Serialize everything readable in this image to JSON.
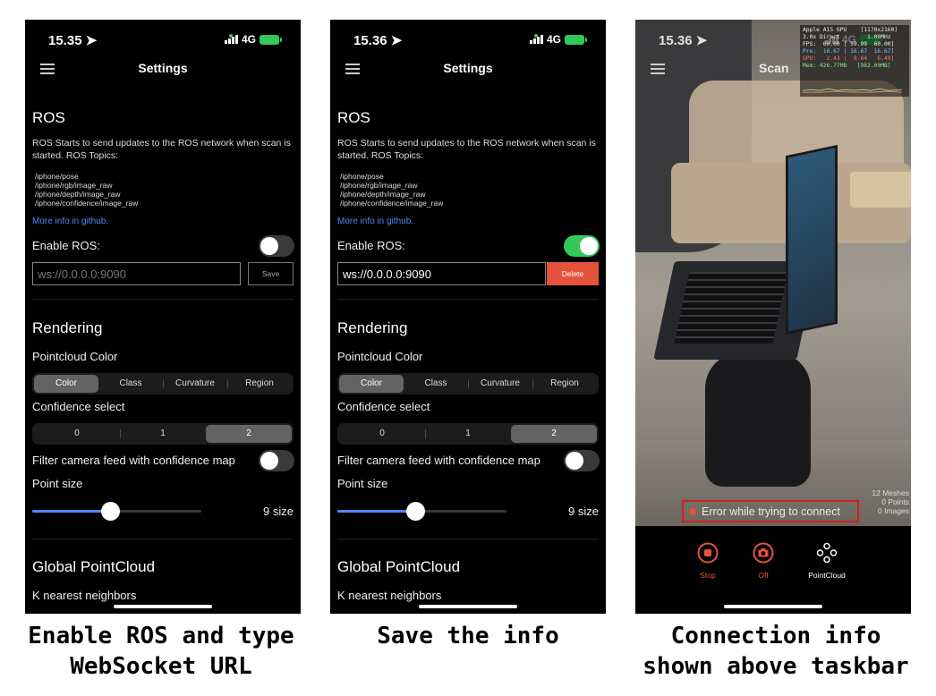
{
  "phones": [
    {
      "status": {
        "time": "15.35 ➤",
        "network": "4G"
      },
      "nav": {
        "title": "Settings"
      },
      "ros": {
        "heading": "ROS",
        "description": "ROS Starts to send updates to the ROS network when scan is started. ROS Topics:",
        "topics": [
          "/iphone/pose",
          "/iphone/rgb/image_raw",
          "/iphone/depth/image_raw",
          "/iphone/confidence/image_raw"
        ],
        "link": "More info in github.",
        "enable_label": "Enable ROS:",
        "enabled": false,
        "url_placeholder": "ws://0.0.0.0:9090",
        "url_value": "",
        "action_label": "Save"
      },
      "rendering": {
        "heading": "Rendering",
        "pointcloud_color_label": "Pointcloud Color",
        "color_options": [
          "Color",
          "Class",
          "Curvature",
          "Region"
        ],
        "color_selected": "Color",
        "confidence_label": "Confidence select",
        "confidence_options": [
          "0",
          "1",
          "2"
        ],
        "confidence_selected": "2",
        "filter_label": "Filter camera feed with confidence map",
        "filter_enabled": false,
        "point_size_label": "Point size",
        "point_size_value": "9 size",
        "point_size_fraction": 0.46
      },
      "global": {
        "heading": "Global PointCloud",
        "knn_label": "K nearest neighbors"
      }
    },
    {
      "status": {
        "time": "15.36 ➤",
        "network": "4G"
      },
      "nav": {
        "title": "Settings"
      },
      "ros": {
        "heading": "ROS",
        "description": "ROS Starts to send updates to the ROS network when scan is started. ROS Topics:",
        "topics": [
          "/iphone/pose",
          "/iphone/rgb/image_raw",
          "/iphone/depth/image_raw",
          "/iphone/confidence/image_raw"
        ],
        "link": "More info in github.",
        "enable_label": "Enable ROS:",
        "enabled": true,
        "url_placeholder": "",
        "url_value": "ws://0.0.0.0:9090",
        "action_label": "Delete"
      },
      "rendering": {
        "heading": "Rendering",
        "pointcloud_color_label": "Pointcloud Color",
        "color_options": [
          "Color",
          "Class",
          "Curvature",
          "Region"
        ],
        "color_selected": "Color",
        "confidence_label": "Confidence select",
        "confidence_options": [
          "0",
          "1",
          "2"
        ],
        "confidence_selected": "2",
        "filter_label": "Filter camera feed with confidence map",
        "filter_enabled": false,
        "point_size_label": "Point size",
        "point_size_value": "9 size",
        "point_size_fraction": 0.46
      },
      "global": {
        "heading": "Global PointCloud",
        "knn_label": "K nearest neighbors"
      }
    }
  ],
  "scan": {
    "time": "15.36 ➤",
    "network": "4G",
    "title": "Scan",
    "hud": [
      {
        "text": "Apple A15 GPU    [1170x2160]",
        "color": "#eeeeee"
      },
      {
        "text": "3.0x Direct        1.00MHz",
        "color": "#eeeeee"
      },
      {
        "text": "FPS:  60.00 | 59.99  60.00]",
        "color": "#eeeeee"
      },
      {
        "text": "Pre:  16.67 | 16.67  16.67]",
        "color": "#7fc1ff"
      },
      {
        "text": "GPU:   2.43 |  0.64   6.49]",
        "color": "#f57d6f"
      },
      {
        "text": "Mem: 426.77MB   [982.00MB]",
        "color": "#8fe38f"
      }
    ],
    "counts": [
      "12 Meshes",
      "0 Points",
      "0 Images"
    ],
    "error_text": "Error while trying to connect",
    "taskbar": [
      {
        "label": "Stop",
        "icon": "stop-icon"
      },
      {
        "label": "Off",
        "icon": "camera-icon"
      },
      {
        "label": "PointCloud",
        "icon": "pointcloud-icon"
      }
    ]
  },
  "captions": [
    "Enable ROS and type\nWebSocket URL",
    "Save the info",
    "Connection info\nshown above taskbar"
  ],
  "colors": {
    "accent_blue": "#4a8cf0",
    "toggle_on": "#34c759",
    "delete_red": "#e5533d",
    "error_border": "#d02020"
  }
}
